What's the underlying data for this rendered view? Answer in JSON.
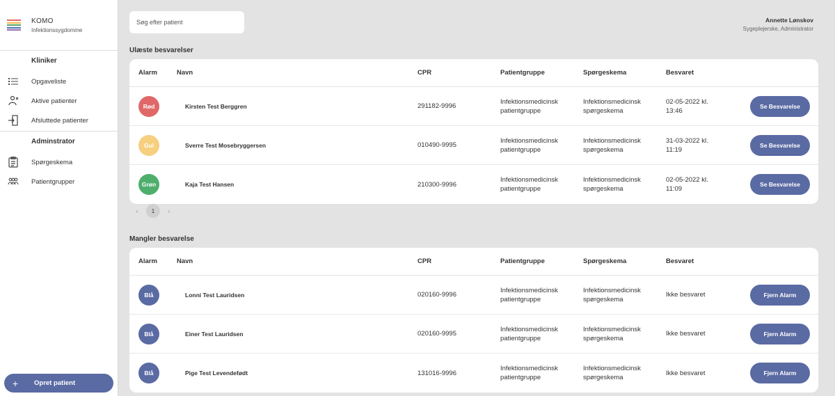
{
  "app": {
    "title": "KOMO",
    "subtitle": "Infektionssygdomme",
    "logo_colors": [
      "#e06a6a",
      "#f2b84b",
      "#5aa469",
      "#4a78b5",
      "#9b6fb0"
    ]
  },
  "sidebar": {
    "sections": [
      {
        "title": "Kliniker",
        "items": [
          {
            "label": "Opgaveliste",
            "icon": "list-icon"
          },
          {
            "label": "Aktive patienter",
            "icon": "active-patients-icon"
          },
          {
            "label": "Afsluttede patienter",
            "icon": "exit-door-icon"
          }
        ]
      },
      {
        "title": "Adminstrator",
        "items": [
          {
            "label": "Spørgeskema",
            "icon": "clipboard-icon"
          },
          {
            "label": "Patientgrupper",
            "icon": "group-icon"
          }
        ]
      }
    ],
    "create_button": {
      "icon": "+",
      "label": "Opret patient"
    }
  },
  "search": {
    "placeholder": "Søg efter patient"
  },
  "user": {
    "name": "Annette Lønskov",
    "role": "Sygeplejerske, Administrator"
  },
  "columns": {
    "alarm": "Alarm",
    "navn": "Navn",
    "cpr": "CPR",
    "group": "Patientgruppe",
    "questionnaire": "Spørgeskema",
    "answered": "Besvaret"
  },
  "colors": {
    "accent": "#5a6aa3",
    "red": "#e06868",
    "yellow": "#f6cf7f",
    "green": "#4eae6c",
    "blue": "#5a6aa3"
  },
  "unread": {
    "title": "Ulæste besvarelser",
    "rows": [
      {
        "alarm": "Rød",
        "alarm_color": "#e06868",
        "name": "Kirsten Test Berggren",
        "cpr": "291182-9996",
        "group1": "Infektionsmedicinsk",
        "group2": "patientgruppe",
        "q1": "Infektionsmedicinsk",
        "q2": "spørgeskema",
        "date1": "02-05-2022 kl.",
        "date2": "13:46",
        "action": "Se Besvarelse"
      },
      {
        "alarm": "Gul",
        "alarm_color": "#f6cf7f",
        "name": "Sverre Test Mosebryggersen",
        "cpr": "010490-9995",
        "group1": "Infektionsmedicinsk",
        "group2": "patientgruppe",
        "q1": "Infektionsmedicinsk",
        "q2": "spørgeskema",
        "date1": "31-03-2022 kl.",
        "date2": "11:19",
        "action": "Se Besvarelse"
      },
      {
        "alarm": "Grøn",
        "alarm_color": "#4eae6c",
        "name": "Kaja Test Hansen",
        "cpr": "210300-9996",
        "group1": "Infektionsmedicinsk",
        "group2": "patientgruppe",
        "q1": "Infektionsmedicinsk",
        "q2": "spørgeskema",
        "date1": "02-05-2022 kl.",
        "date2": "11:09",
        "action": "Se Besvarelse"
      }
    ],
    "pager": {
      "prev": "‹",
      "page": "1",
      "next": "›"
    }
  },
  "missing": {
    "title": "Mangler besvarelse",
    "rows": [
      {
        "alarm": "Blå",
        "alarm_color": "#5a6aa3",
        "name": "Lonni Test Lauridsen",
        "cpr": "020160-9996",
        "group1": "Infektionsmedicinsk",
        "group2": "patientgruppe",
        "q1": "Infektionsmedicinsk",
        "q2": "spørgeskema",
        "date1": "Ikke besvaret",
        "date2": "",
        "action": "Fjern Alarm"
      },
      {
        "alarm": "Blå",
        "alarm_color": "#5a6aa3",
        "name": "Einer Test Lauridsen",
        "cpr": "020160-9995",
        "group1": "Infektionsmedicinsk",
        "group2": "patientgruppe",
        "q1": "Infektionsmedicinsk",
        "q2": "spørgeskema",
        "date1": "Ikke besvaret",
        "date2": "",
        "action": "Fjern Alarm"
      },
      {
        "alarm": "Blå",
        "alarm_color": "#5a6aa3",
        "name": "Pige Test Levendefødt",
        "cpr": "131016-9996",
        "group1": "Infektionsmedicinsk",
        "group2": "patientgruppe",
        "q1": "Infektionsmedicinsk",
        "q2": "spørgeskema",
        "date1": "Ikke besvaret",
        "date2": "",
        "action": "Fjern Alarm"
      }
    ]
  }
}
